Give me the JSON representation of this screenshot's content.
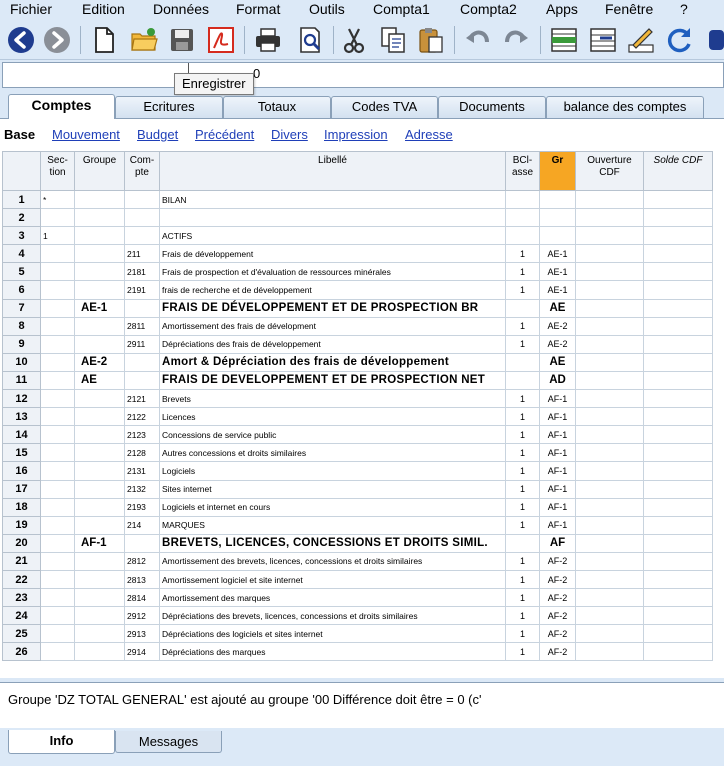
{
  "menu": [
    "Fichier",
    "Edition",
    "Données",
    "Format",
    "Outils",
    "Compta1",
    "Compta2",
    "Apps",
    "Fenêtre",
    "?"
  ],
  "toolbar": {
    "icons": [
      "back-icon",
      "forward-icon",
      "new-file-icon",
      "open-folder-icon",
      "save-icon",
      "pdf-icon",
      "print-icon",
      "print-preview-icon",
      "cut-icon",
      "copy-icon",
      "paste-icon",
      "undo-icon",
      "redo-icon",
      "insert-rows-icon",
      "delete-rows-icon",
      "edit-pencil-icon",
      "refresh-icon"
    ]
  },
  "editline": {
    "value": "0"
  },
  "tooltip": "Enregistrer",
  "tabs_top": [
    "Comptes",
    "Ecritures",
    "Totaux",
    "Codes TVA",
    "Documents",
    "balance des comptes"
  ],
  "views": [
    "Base",
    "Mouvement",
    "Budget",
    "Précédent",
    "Divers",
    "Impression",
    "Adresse"
  ],
  "columns": {
    "section": "Sec-tion",
    "groupe": "Groupe",
    "compte": "Com-pte",
    "libelle": "Libellé",
    "bciasse": "BCl-asse",
    "gr": "Gr",
    "ouverture": "Ouverture CDF",
    "solde": "Solde CDF"
  },
  "rows": [
    {
      "n": "1",
      "section": "*",
      "groupe": "",
      "compte": "",
      "libelle": "BILAN",
      "bciasse": "",
      "gr": "",
      "bold": false
    },
    {
      "n": "2",
      "section": "",
      "groupe": "",
      "compte": "",
      "libelle": "",
      "bciasse": "",
      "gr": "",
      "bold": false
    },
    {
      "n": "3",
      "section": "1",
      "groupe": "",
      "compte": "",
      "libelle": "ACTIFS",
      "bciasse": "",
      "gr": "",
      "bold": false
    },
    {
      "n": "4",
      "section": "",
      "groupe": "",
      "compte": "211",
      "libelle": "Frais de développement",
      "bciasse": "1",
      "gr": "AE-1",
      "bold": false
    },
    {
      "n": "5",
      "section": "",
      "groupe": "",
      "compte": "2181",
      "libelle": "Frais de prospection et d'évaluation de ressources minérales",
      "bciasse": "1",
      "gr": "AE-1",
      "bold": false
    },
    {
      "n": "6",
      "section": "",
      "groupe": "",
      "compte": "2191",
      "libelle": "frais de recherche et de développement",
      "bciasse": "1",
      "gr": "AE-1",
      "bold": false
    },
    {
      "n": "7",
      "section": "",
      "groupe": "AE-1",
      "compte": "",
      "libelle": "FRAIS DE DÉVELOPPEMENT ET DE PROSPECTION BR",
      "bciasse": "",
      "gr": "AE",
      "bold": true
    },
    {
      "n": "8",
      "section": "",
      "groupe": "",
      "compte": "2811",
      "libelle": "Amortissement des frais de dévelopment",
      "bciasse": "1",
      "gr": "AE-2",
      "bold": false
    },
    {
      "n": "9",
      "section": "",
      "groupe": "",
      "compte": "2911",
      "libelle": "Dépréciations des frais de développement",
      "bciasse": "1",
      "gr": "AE-2",
      "bold": false
    },
    {
      "n": "10",
      "section": "",
      "groupe": "AE-2",
      "compte": "",
      "libelle": "Amort & Dépréciation des frais de développement",
      "bciasse": "",
      "gr": "AE",
      "bold": true
    },
    {
      "n": "11",
      "section": "",
      "groupe": "AE",
      "compte": "",
      "libelle": "FRAIS DE DEVELOPPEMENT ET DE PROSPECTION NET",
      "bciasse": "",
      "gr": "AD",
      "bold": true
    },
    {
      "n": "12",
      "section": "",
      "groupe": "",
      "compte": "2121",
      "libelle": "Brevets",
      "bciasse": "1",
      "gr": "AF-1",
      "bold": false
    },
    {
      "n": "13",
      "section": "",
      "groupe": "",
      "compte": "2122",
      "libelle": "Licences",
      "bciasse": "1",
      "gr": "AF-1",
      "bold": false
    },
    {
      "n": "14",
      "section": "",
      "groupe": "",
      "compte": "2123",
      "libelle": "Concessions de service public",
      "bciasse": "1",
      "gr": "AF-1",
      "bold": false
    },
    {
      "n": "15",
      "section": "",
      "groupe": "",
      "compte": "2128",
      "libelle": "Autres concessions et droits similaires",
      "bciasse": "1",
      "gr": "AF-1",
      "bold": false
    },
    {
      "n": "16",
      "section": "",
      "groupe": "",
      "compte": "2131",
      "libelle": "Logiciels",
      "bciasse": "1",
      "gr": "AF-1",
      "bold": false
    },
    {
      "n": "17",
      "section": "",
      "groupe": "",
      "compte": "2132",
      "libelle": "Sites internet",
      "bciasse": "1",
      "gr": "AF-1",
      "bold": false
    },
    {
      "n": "18",
      "section": "",
      "groupe": "",
      "compte": "2193",
      "libelle": "Logiciels et internet en cours",
      "bciasse": "1",
      "gr": "AF-1",
      "bold": false
    },
    {
      "n": "19",
      "section": "",
      "groupe": "",
      "compte": "214",
      "libelle": "MARQUES",
      "bciasse": "1",
      "gr": "AF-1",
      "bold": false
    },
    {
      "n": "20",
      "section": "",
      "groupe": "AF-1",
      "compte": "",
      "libelle": "BREVETS, LICENCES, CONCESSIONS ET DROITS SIMIL.",
      "bciasse": "",
      "gr": "AF",
      "bold": true
    },
    {
      "n": "21",
      "section": "",
      "groupe": "",
      "compte": "2812",
      "libelle": "Amortissement des brevets, licences, concessions et droits similaires",
      "bciasse": "1",
      "gr": "AF-2",
      "bold": false
    },
    {
      "n": "22",
      "section": "",
      "groupe": "",
      "compte": "2813",
      "libelle": "Amortissement logiciel et site internet",
      "bciasse": "1",
      "gr": "AF-2",
      "bold": false
    },
    {
      "n": "23",
      "section": "",
      "groupe": "",
      "compte": "2814",
      "libelle": "Amortissement des marques",
      "bciasse": "1",
      "gr": "AF-2",
      "bold": false
    },
    {
      "n": "24",
      "section": "",
      "groupe": "",
      "compte": "2912",
      "libelle": "Dépréciations des brevets, licences, concessions et droits similaires",
      "bciasse": "1",
      "gr": "AF-2",
      "bold": false
    },
    {
      "n": "25",
      "section": "",
      "groupe": "",
      "compte": "2913",
      "libelle": "Dépréciations des logiciels et sites internet",
      "bciasse": "1",
      "gr": "AF-2",
      "bold": false
    },
    {
      "n": "26",
      "section": "",
      "groupe": "",
      "compte": "2914",
      "libelle": "Dépréciations des marques",
      "bciasse": "1",
      "gr": "AF-2",
      "bold": false
    }
  ],
  "message": "Groupe 'DZ TOTAL GENERAL' est ajouté au groupe '00 Différence doit être = 0 (c'",
  "tabs_bottom": [
    "Info",
    "Messages"
  ]
}
